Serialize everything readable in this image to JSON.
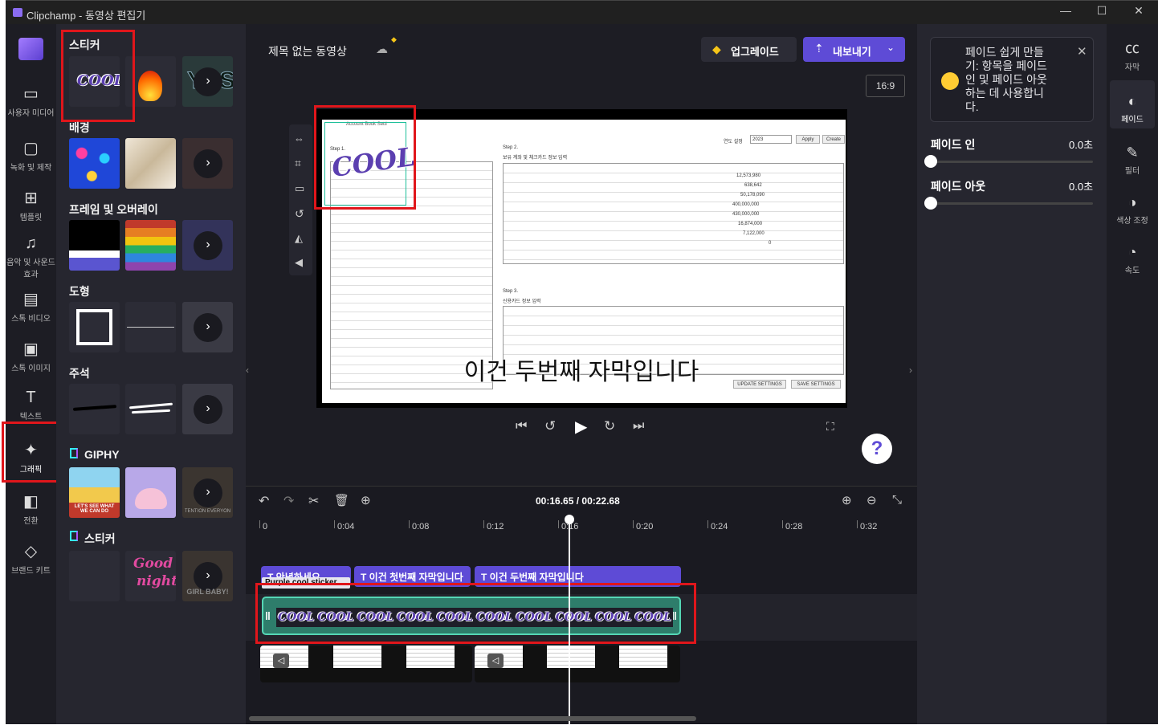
{
  "window": {
    "title": "Clipchamp - 동영상 편집기",
    "minimize": "—",
    "maximize": "☐",
    "close": "✕"
  },
  "left_nav": [
    {
      "label": "사용자 미디어",
      "icon": "folder-icon"
    },
    {
      "label": "녹화 및 제작",
      "icon": "camera-icon"
    },
    {
      "label": "템플릿",
      "icon": "template-icon"
    },
    {
      "label": "음악 및 사운드 효과",
      "icon": "music-icon"
    },
    {
      "label": "스톡 비디오",
      "icon": "film-icon"
    },
    {
      "label": "스톡 이미지",
      "icon": "image-icon"
    },
    {
      "label": "텍스트",
      "icon": "text-icon"
    },
    {
      "label": "그래픽",
      "icon": "shapes-icon"
    },
    {
      "label": "전환",
      "icon": "transition-icon"
    },
    {
      "label": "브랜드 키트",
      "icon": "brand-icon"
    }
  ],
  "panel": {
    "sections": {
      "stickers": "스티커",
      "backgrounds": "배경",
      "frames": "프레임 및 오버레이",
      "shapes": "도형",
      "annotations": "주석",
      "giphy": "GIPHY",
      "stickers2": "스티커"
    },
    "sticker_cool": "COOL",
    "sticker_yes": "YES",
    "giphy_caption1": "LET'S SEE WHAT WE CAN DO",
    "giphy_caption3": "TENTION EVERYON",
    "sticker2_good": "Good",
    "sticker2_night": "night",
    "sticker2_baby": "GIRL BABY!",
    "more_arrow": "›"
  },
  "editor": {
    "project_title": "제목 없는 동영상",
    "upgrade_label": "업그레이드",
    "export_label": "내보내기",
    "aspect_ratio": "16:9",
    "subtitle_overlay": "이건 두번째 자막입니다",
    "help_label": "?"
  },
  "preview_doc": {
    "app_label": "Account Book Setti",
    "step1": "Step 1.",
    "step2": "Step 2.",
    "step2_desc": "보유 계좌 및 체크카드 정보 입력",
    "step3": "Step 3.",
    "step3_desc": "신용카드 정보 입력",
    "year_label": "연도 설정",
    "year_value": "2023",
    "apply": "Apply",
    "create": "Create",
    "update_settings": "UPDATE SETTINGS",
    "save_settings": "SAVE SETTINGS",
    "amounts": [
      "12,573,980",
      "638,642",
      "50,178,090",
      "400,000,000",
      "430,000,000",
      "16,874,000",
      "7,122,000",
      "0"
    ]
  },
  "timeline": {
    "current_time": "00:16.65",
    "separator": "/",
    "total_time": "00:22.68",
    "ticks": [
      "0",
      "0:04",
      "0:08",
      "0:12",
      "0:16",
      "0:20",
      "0:24",
      "0:28",
      "0:32"
    ],
    "text_clips": [
      "안녕하세요",
      "이건 첫번째 자막입니다",
      "이건 두번째 자막입니다"
    ],
    "sticker_clip_label": "Purple cool sticker",
    "sticker_thumb": "COOL"
  },
  "props": {
    "tip_text": "페이드 쉽게 만들기: 항목을 페이드 인 및 페이드 아웃하는 데 사용합니다.",
    "fade_in_label": "페이드 인",
    "fade_in_value": "0.0초",
    "fade_out_label": "페이드 아웃",
    "fade_out_value": "0.0초"
  },
  "right_nav": [
    {
      "label": "자막",
      "icon": "captions-icon"
    },
    {
      "label": "페이드",
      "icon": "fade-icon"
    },
    {
      "label": "필터",
      "icon": "filter-icon"
    },
    {
      "label": "색상 조정",
      "icon": "color-adjust-icon"
    },
    {
      "label": "속도",
      "icon": "speed-icon"
    }
  ],
  "colors": {
    "accent": "#5e4bd6",
    "highlight": "#e0161b",
    "sticker_clip": "#2e7d6b"
  }
}
